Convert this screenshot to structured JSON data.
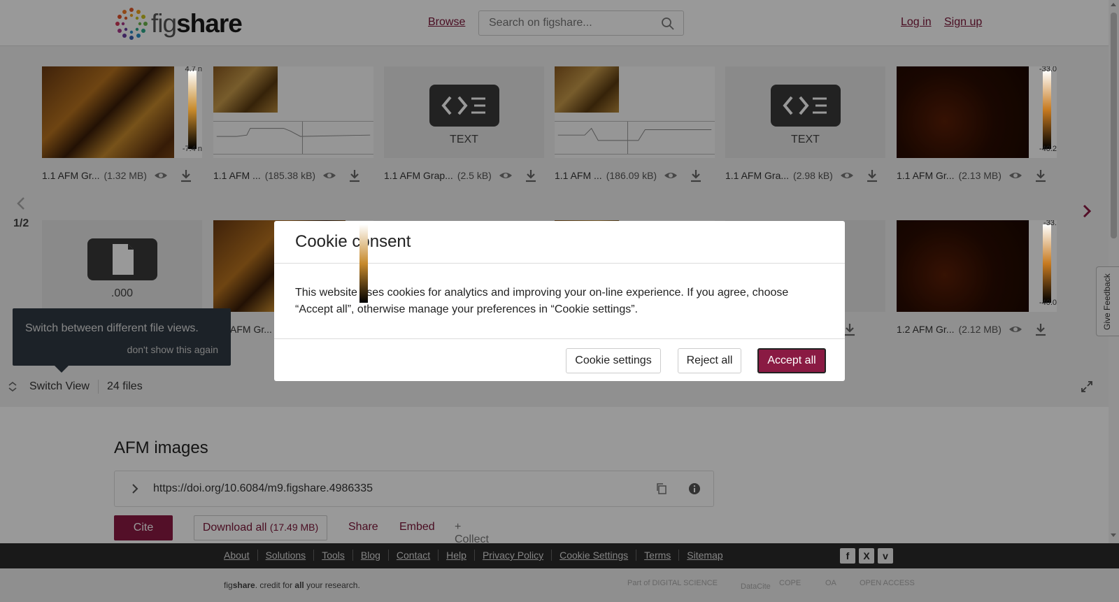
{
  "header": {
    "logo_fig": "fig",
    "logo_share": "share",
    "browse": "Browse",
    "search_placeholder": "Search on figshare...",
    "login": "Log in",
    "signup": "Sign up"
  },
  "viewer": {
    "page_indicator": "1/2",
    "files_row1": [
      {
        "name": "1.1 AFM Gr...",
        "size": "(1.32 MB)",
        "type": "afm",
        "scale_top": "4.7 n",
        "scale_bottom": "-7.4 n"
      },
      {
        "name": "1.1 AFM ...",
        "size": "(185.38 kB)",
        "type": "profile"
      },
      {
        "name": "1.1 AFM Grap...",
        "size": "(2.5 kB)",
        "type": "text",
        "label": "TEXT"
      },
      {
        "name": "1.1 AFM ...",
        "size": "(186.09 kB)",
        "type": "profile"
      },
      {
        "name": "1.1 AFM Gra...",
        "size": "(2.98 kB)",
        "type": "text",
        "label": "TEXT"
      },
      {
        "name": "1.1 AFM Gr...",
        "size": "(2.13 MB)",
        "type": "dark",
        "scale_top": "-33.0",
        "scale_bottom": "-40.2"
      }
    ],
    "files_row2": [
      {
        "type": "file",
        "label": ".000"
      },
      {
        "name": "AFM Gr...",
        "type": "afm"
      },
      {
        "name": "1.2 AFM Gr...",
        "size": "(2.12 MB)",
        "type": "dark",
        "scale_top": "-33.",
        "scale_bottom": "-40.0"
      }
    ],
    "tooltip_text": "Switch between different file views.",
    "tooltip_dismiss": "don't show this again",
    "switch_view": "Switch View",
    "file_count": "24 files"
  },
  "content": {
    "title": "AFM images",
    "doi": "https://doi.org/10.6084/m9.figshare.4986335",
    "cite": "Cite",
    "download_all": "Download all",
    "download_size": "(17.49 MB)",
    "share": "Share",
    "embed": "Embed",
    "collect": "+ Collect"
  },
  "feedback": "Give Feedback",
  "footer": {
    "links": [
      "About",
      "Solutions",
      "Tools",
      "Blog",
      "Contact",
      "Help",
      "Privacy Policy",
      "Cookie Settings",
      "Terms",
      "Sitemap"
    ],
    "tagline_fig": "fig",
    "tagline_share": "share",
    "tagline_mid": ". credit for ",
    "tagline_all": "all",
    "tagline_end": " your research.",
    "partners": [
      "Part of DIGITAL SCIENCE",
      "DataCite",
      "COPE",
      "OA",
      "OPEN ACCESS"
    ]
  },
  "cookie": {
    "title": "Cookie consent",
    "body": "This website uses cookies for analytics and improving your on-line experience. If you agree, choose “Accept all”, otherwise manage your preferences in “Cookie settings”.",
    "settings": "Cookie settings",
    "reject": "Reject all",
    "accept": "Accept all"
  },
  "colors": {
    "brand": "#8a1a43",
    "footer_dark": "#2a2a2a"
  }
}
